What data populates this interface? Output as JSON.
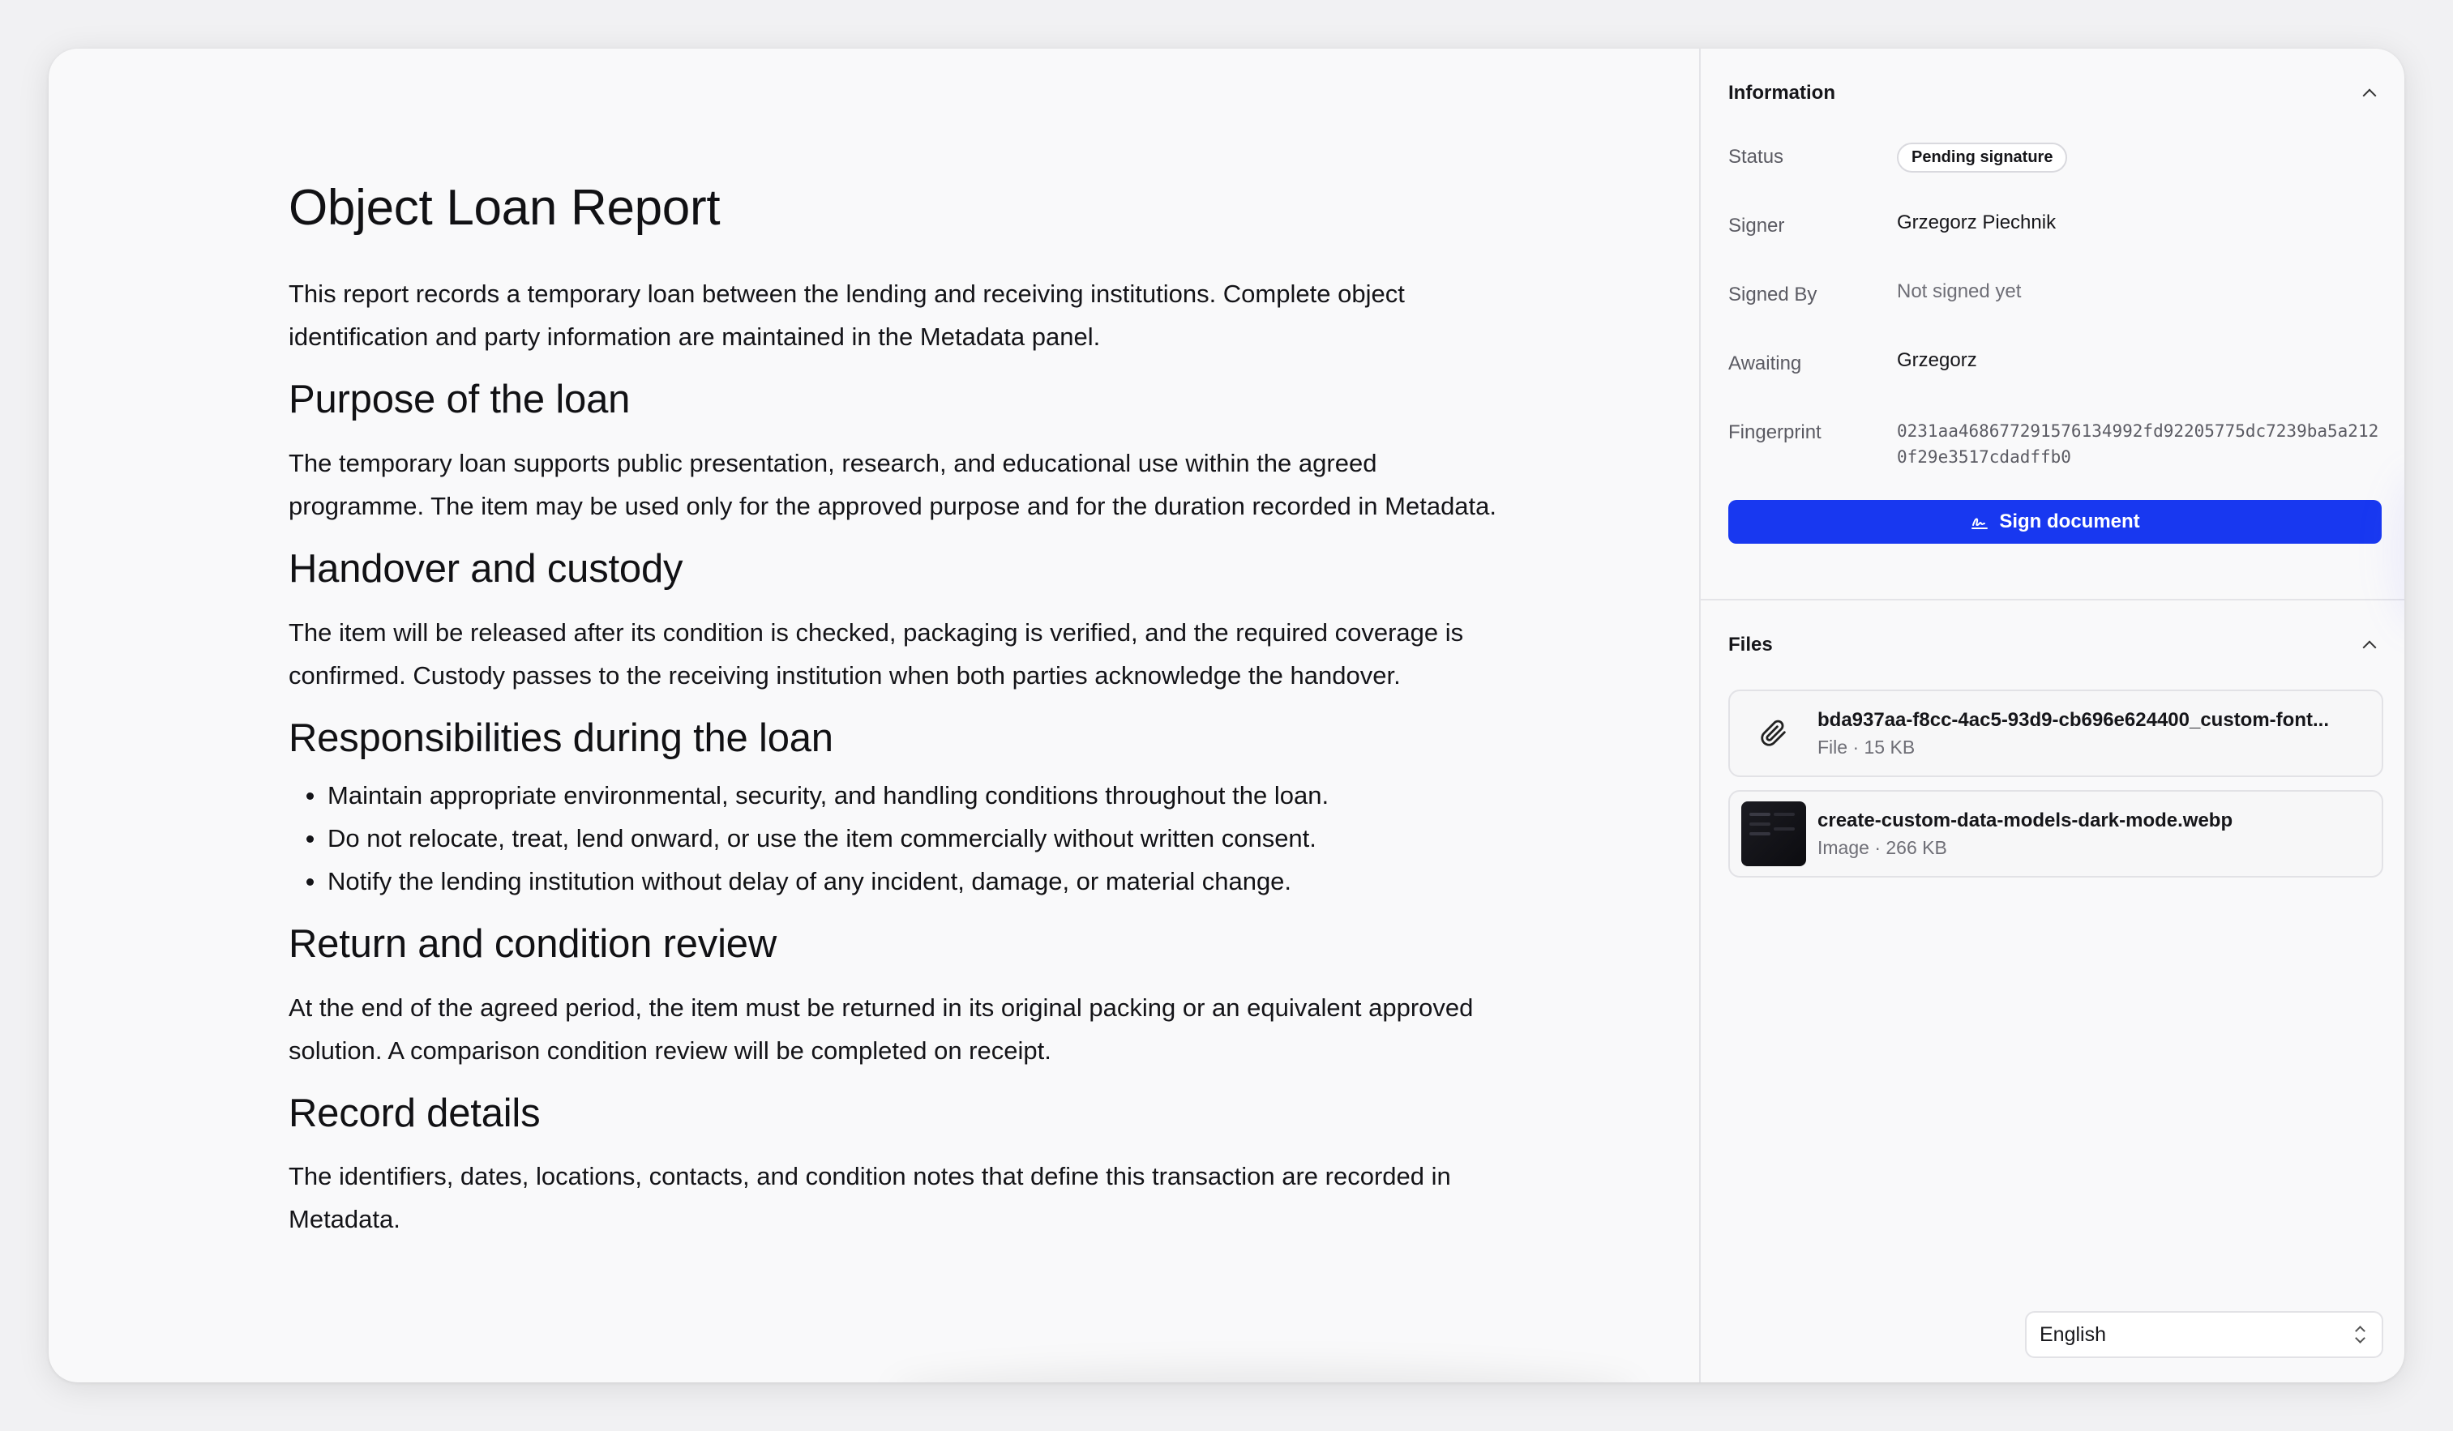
{
  "document": {
    "title": "Object Loan Report",
    "intro": "This report records a temporary loan between the lending and receiving institutions. Complete object identification and party information are maintained in the Metadata panel.",
    "sections": [
      {
        "heading": "Purpose of the loan",
        "body": "The temporary loan supports public presentation, research, and educational use within the agreed programme. The item may be used only for the approved purpose and for the duration recorded in Metadata."
      },
      {
        "heading": "Handover and custody",
        "body": "The item will be released after its condition is checked, packaging is verified, and the required coverage is confirmed. Custody passes to the receiving institution when both parties acknowledge the handover."
      },
      {
        "heading": "Responsibilities during the loan",
        "bullets": [
          "Maintain appropriate environmental, security, and handling conditions throughout the loan.",
          "Do not relocate, treat, lend onward, or use the item commercially without written consent.",
          "Notify the lending institution without delay of any incident, damage, or material change."
        ]
      },
      {
        "heading": "Return and condition review",
        "body": "At the end of the agreed period, the item must be returned in its original packing or an equivalent approved solution. A comparison condition review will be completed on receipt."
      },
      {
        "heading": "Record details",
        "body": "The identifiers, dates, locations, contacts, and condition notes that define this transaction are recorded in Metadata."
      }
    ]
  },
  "information": {
    "title": "Information",
    "rows": {
      "status": {
        "label": "Status",
        "value": "Pending signature"
      },
      "signer": {
        "label": "Signer",
        "value": "Grzegorz Piechnik"
      },
      "signed_by": {
        "label": "Signed By",
        "value": "Not signed yet"
      },
      "awaiting": {
        "label": "Awaiting",
        "value": "Grzegorz"
      },
      "fingerprint": {
        "label": "Fingerprint",
        "value": "0231aa468677291576134992fd92205775dc7239ba5a2120f29e3517cdadffb0"
      }
    },
    "sign_button": "Sign document",
    "sign_icon": "signature-icon",
    "accent_color": "#1838f0"
  },
  "files": {
    "title": "Files",
    "items": [
      {
        "name": "bda937aa-f8cc-4ac5-93d9-cb696e624400_custom-font...",
        "meta": "File · 15 KB",
        "icon": "paperclip-icon"
      },
      {
        "name": "create-custom-data-models-dark-mode.webp",
        "meta": "Image · 266 KB",
        "icon": "image-thumbnail"
      }
    ]
  },
  "language": {
    "selected": "English"
  }
}
